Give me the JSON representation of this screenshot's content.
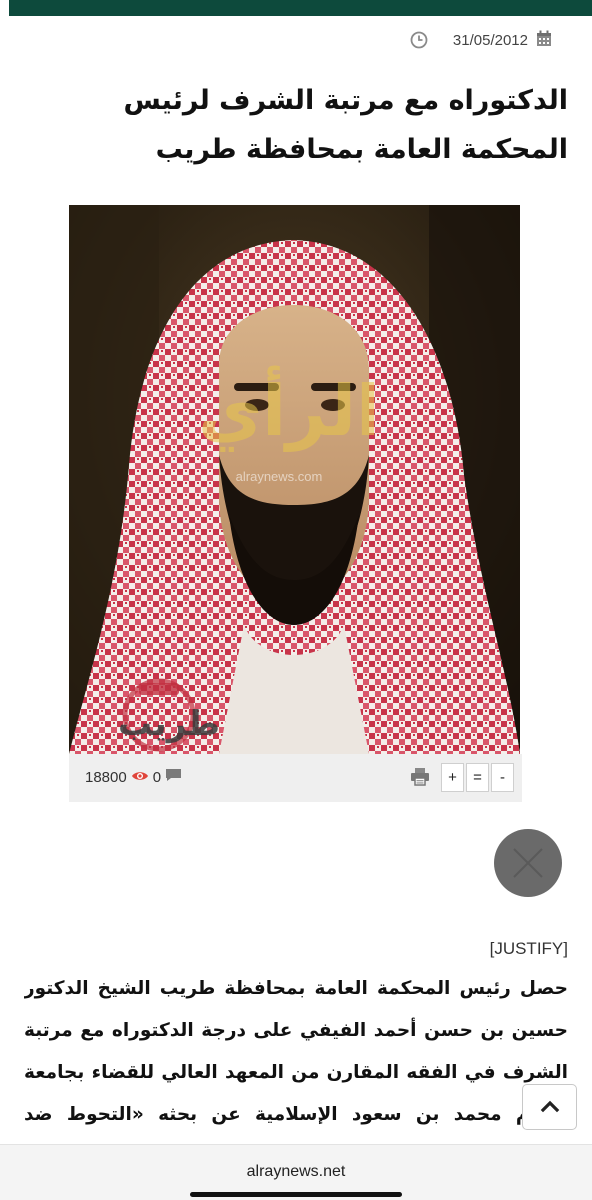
{
  "article": {
    "date": "31/05/2012",
    "title": "الدكتوراه مع مرتبة الشرف لرئيس المحكمة العامة بمحافظة طريب",
    "image": {
      "watermark_logo_text": "طريب",
      "watermark_site": "alraynews.com",
      "watermark_mark": "الرأي"
    },
    "stats": {
      "views": "18800",
      "comments": "0"
    },
    "font_controls": {
      "plus": "+",
      "reset": "=",
      "minus": "-"
    },
    "justify_tag": "[JUSTIFY]",
    "body": "حصل رئيس المحكمة العامة بمحافظة طريب الشيخ الدكتور حسين بن حسن أحمد الفيفي على درجة الدكتوراه مع مرتبة الشرف في الفقه المقارن من المعهد العالي للقضاء بجامعة الإمام محمد بن سعود الإسلامية عن بحثه «التحوط ضد مخاطر الاستثمار في المصارف الإسلامية: دراسة فقهية"
  },
  "browser": {
    "url": "alraynews.net"
  },
  "colors": {
    "topbar": "#0d4a3c",
    "eye": "#e0443a",
    "loader": "#6a6a6a"
  },
  "icons": [
    "calendar-icon",
    "clock-icon",
    "eye-icon",
    "comment-icon",
    "print-icon",
    "chevron-up-icon"
  ]
}
